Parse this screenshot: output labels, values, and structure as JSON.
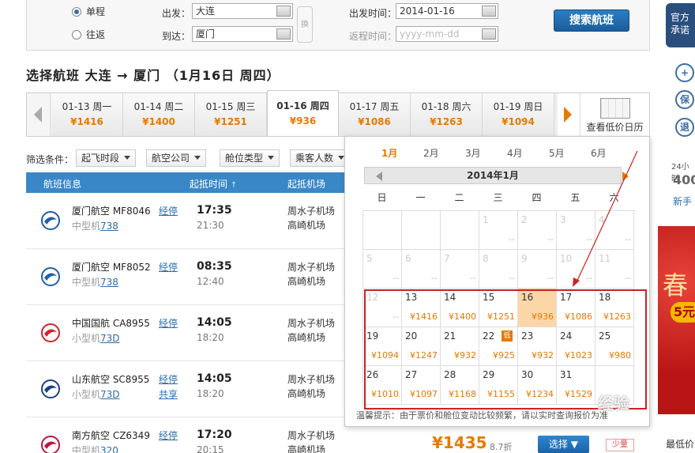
{
  "search": {
    "trip_types": [
      {
        "label": "单程",
        "selected": true
      },
      {
        "label": "往返",
        "selected": false
      }
    ],
    "from_label": "出发：",
    "from_value": "大连",
    "to_label": "到达：",
    "to_value": "厦门",
    "depart_label": "出发时间：",
    "depart_value": "2014-01-16",
    "return_label": "返程时间：",
    "return_placeholder": "yyyy-mm-dd",
    "swap_label": "换",
    "submit_label": "搜索航班"
  },
  "side": {
    "badge": "官方\n承诺",
    "icons": [
      "保",
      "退"
    ],
    "hours_text": "24小时",
    "hotline": "400",
    "newbie": "新手",
    "promo_big": "春",
    "promo_pill": "5元",
    "footer": "最低价"
  },
  "page_title": "选择航班  大连 → 厦门 （1月16日 周四）",
  "date_strip": {
    "days": [
      {
        "date": "01-13 周一",
        "price": "¥1416",
        "active": false
      },
      {
        "date": "01-14 周二",
        "price": "¥1400",
        "active": false
      },
      {
        "date": "01-15 周三",
        "price": "¥1251",
        "active": false
      },
      {
        "date": "01-16 周四",
        "price": "¥936",
        "active": true
      },
      {
        "date": "01-17 周五",
        "price": "¥1086",
        "active": false
      },
      {
        "date": "01-18 周六",
        "price": "¥1263",
        "active": false
      },
      {
        "date": "01-19 周日",
        "price": "¥1094",
        "active": false
      }
    ],
    "low_calendar_label": "查看低价日历"
  },
  "filters": {
    "label": "筛选条件：",
    "buttons": [
      "起飞时段",
      "航空公司",
      "舱位类型",
      "乘客人数"
    ]
  },
  "table": {
    "headers": [
      "航班信息",
      "起抵时间",
      "起抵机场"
    ],
    "sort_arrow": "↑",
    "rows": [
      {
        "airline": "厦门航空 MF8046",
        "plane_prefix": "中型机",
        "plane_code": "738",
        "stop": "经停",
        "share": "",
        "dep": "17:35",
        "arr": "21:30",
        "apt1": "周水子机场",
        "apt2": "高崎机场",
        "logo": "xiamen-air",
        "color": "#1f5fa8"
      },
      {
        "airline": "厦门航空 MF8052",
        "plane_prefix": "中型机",
        "plane_code": "738",
        "stop": "经停",
        "share": "",
        "dep": "08:35",
        "arr": "12:40",
        "apt1": "周水子机场",
        "apt2": "高崎机场",
        "logo": "xiamen-air",
        "color": "#1f5fa8"
      },
      {
        "airline": "中国国航 CA8955",
        "plane_prefix": "小型机",
        "plane_code": "73D",
        "stop": "经停",
        "share": "",
        "dep": "14:05",
        "arr": "18:20",
        "apt1": "周水子机场",
        "apt2": "高崎机场",
        "logo": "air-china",
        "color": "#d2232a"
      },
      {
        "airline": "山东航空 SC8955",
        "plane_prefix": "小型机",
        "plane_code": "73D",
        "stop": "经停",
        "share": "共享",
        "dep": "14:05",
        "arr": "18:20",
        "apt1": "周水子机场",
        "apt2": "高崎机场",
        "logo": "shandong-air",
        "color": "#1a3f8a"
      },
      {
        "airline": "南方航空 CZ6349",
        "plane_prefix": "中型机",
        "plane_code": "320",
        "stop": "经停",
        "share": "",
        "dep": "17:20",
        "arr": "20:15",
        "apt1": "周水子机场",
        "apt2": "高崎机场",
        "logo": "china-southern",
        "color": "#c0143c"
      }
    ]
  },
  "bottom_row": {
    "price": "¥1435",
    "discount": "8.7折",
    "select_label": "选择",
    "less_label": "少量"
  },
  "calendar": {
    "months": [
      "1月",
      "2月",
      "3月",
      "4月",
      "5月",
      "6月"
    ],
    "active_month": 0,
    "month_title": "2014年1月",
    "weekdays": [
      "日",
      "一",
      "二",
      "三",
      "四",
      "五",
      "六"
    ],
    "weeks": [
      [
        {
          "n": "",
          "p": ""
        },
        {
          "n": "",
          "p": ""
        },
        {
          "n": "",
          "p": ""
        },
        {
          "n": "1",
          "p": "--",
          "g": true
        },
        {
          "n": "2",
          "p": "--",
          "g": true
        },
        {
          "n": "3",
          "p": "--",
          "g": true
        },
        {
          "n": "4",
          "p": "--",
          "g": true
        }
      ],
      [
        {
          "n": "5",
          "p": "--",
          "g": true
        },
        {
          "n": "6",
          "p": "--",
          "g": true
        },
        {
          "n": "7",
          "p": "--",
          "g": true
        },
        {
          "n": "8",
          "p": "--",
          "g": true
        },
        {
          "n": "9",
          "p": "--",
          "g": true
        },
        {
          "n": "10",
          "p": "--",
          "g": true
        },
        {
          "n": "11",
          "p": "--",
          "g": true
        }
      ],
      [
        {
          "n": "12",
          "p": "--",
          "g": true
        },
        {
          "n": "13",
          "p": "¥1416"
        },
        {
          "n": "14",
          "p": "¥1400"
        },
        {
          "n": "15",
          "p": "¥1251"
        },
        {
          "n": "16",
          "p": "¥936",
          "today": true
        },
        {
          "n": "17",
          "p": "¥1086"
        },
        {
          "n": "18",
          "p": "¥1263"
        }
      ],
      [
        {
          "n": "19",
          "p": "¥1094"
        },
        {
          "n": "20",
          "p": "¥1247"
        },
        {
          "n": "21",
          "p": "¥932"
        },
        {
          "n": "22",
          "p": "¥925",
          "low": "低"
        },
        {
          "n": "23",
          "p": "¥932"
        },
        {
          "n": "24",
          "p": "¥1023"
        },
        {
          "n": "25",
          "p": "¥980"
        }
      ],
      [
        {
          "n": "26",
          "p": "¥1010"
        },
        {
          "n": "27",
          "p": "¥1097"
        },
        {
          "n": "28",
          "p": "¥1168"
        },
        {
          "n": "29",
          "p": "¥1155"
        },
        {
          "n": "30",
          "p": "¥1234"
        },
        {
          "n": "31",
          "p": "¥1529"
        },
        {
          "n": "",
          "p": ""
        }
      ]
    ],
    "tip": "温馨提示：由于票价和舱位变动比较频繁，请以实时查询报价为准"
  },
  "watermark": "经验"
}
